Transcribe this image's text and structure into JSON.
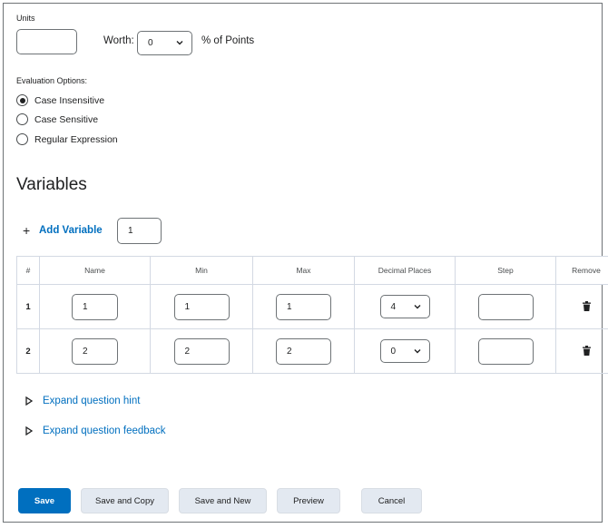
{
  "units": {
    "label": "Units",
    "value": "",
    "worth_label": "Worth:",
    "worth_value": "0",
    "percent_label": "% of Points"
  },
  "evaluation": {
    "label": "Evaluation Options:",
    "options": [
      {
        "label": "Case Insensitive",
        "checked": true
      },
      {
        "label": "Case Sensitive",
        "checked": false
      },
      {
        "label": "Regular Expression",
        "checked": false
      }
    ]
  },
  "variables": {
    "heading": "Variables",
    "add_plus": "+",
    "add_label": "Add Variable",
    "count_value": "1",
    "columns": [
      "#",
      "Name",
      "Min",
      "Max",
      "Decimal Places",
      "Step",
      "Remove"
    ],
    "rows": [
      {
        "num": "1",
        "name": "1",
        "min": "1",
        "max": "1",
        "decimal_places": "4",
        "step": ""
      },
      {
        "num": "2",
        "name": "2",
        "min": "2",
        "max": "2",
        "decimal_places": "0",
        "step": ""
      }
    ]
  },
  "expanders": {
    "hint": "Expand question hint",
    "feedback": "Expand question feedback"
  },
  "buttons": {
    "save": "Save",
    "save_copy": "Save and Copy",
    "save_new": "Save and New",
    "preview": "Preview",
    "cancel": "Cancel"
  },
  "colors": {
    "primary": "#006fbf",
    "link": "#006fbf",
    "secondary_button": "#e3e9f1",
    "border": "#6e7376"
  },
  "icons": {
    "chevron": "chevron-down-icon",
    "remove": "trash-icon",
    "expander": "triangle-right-icon"
  }
}
